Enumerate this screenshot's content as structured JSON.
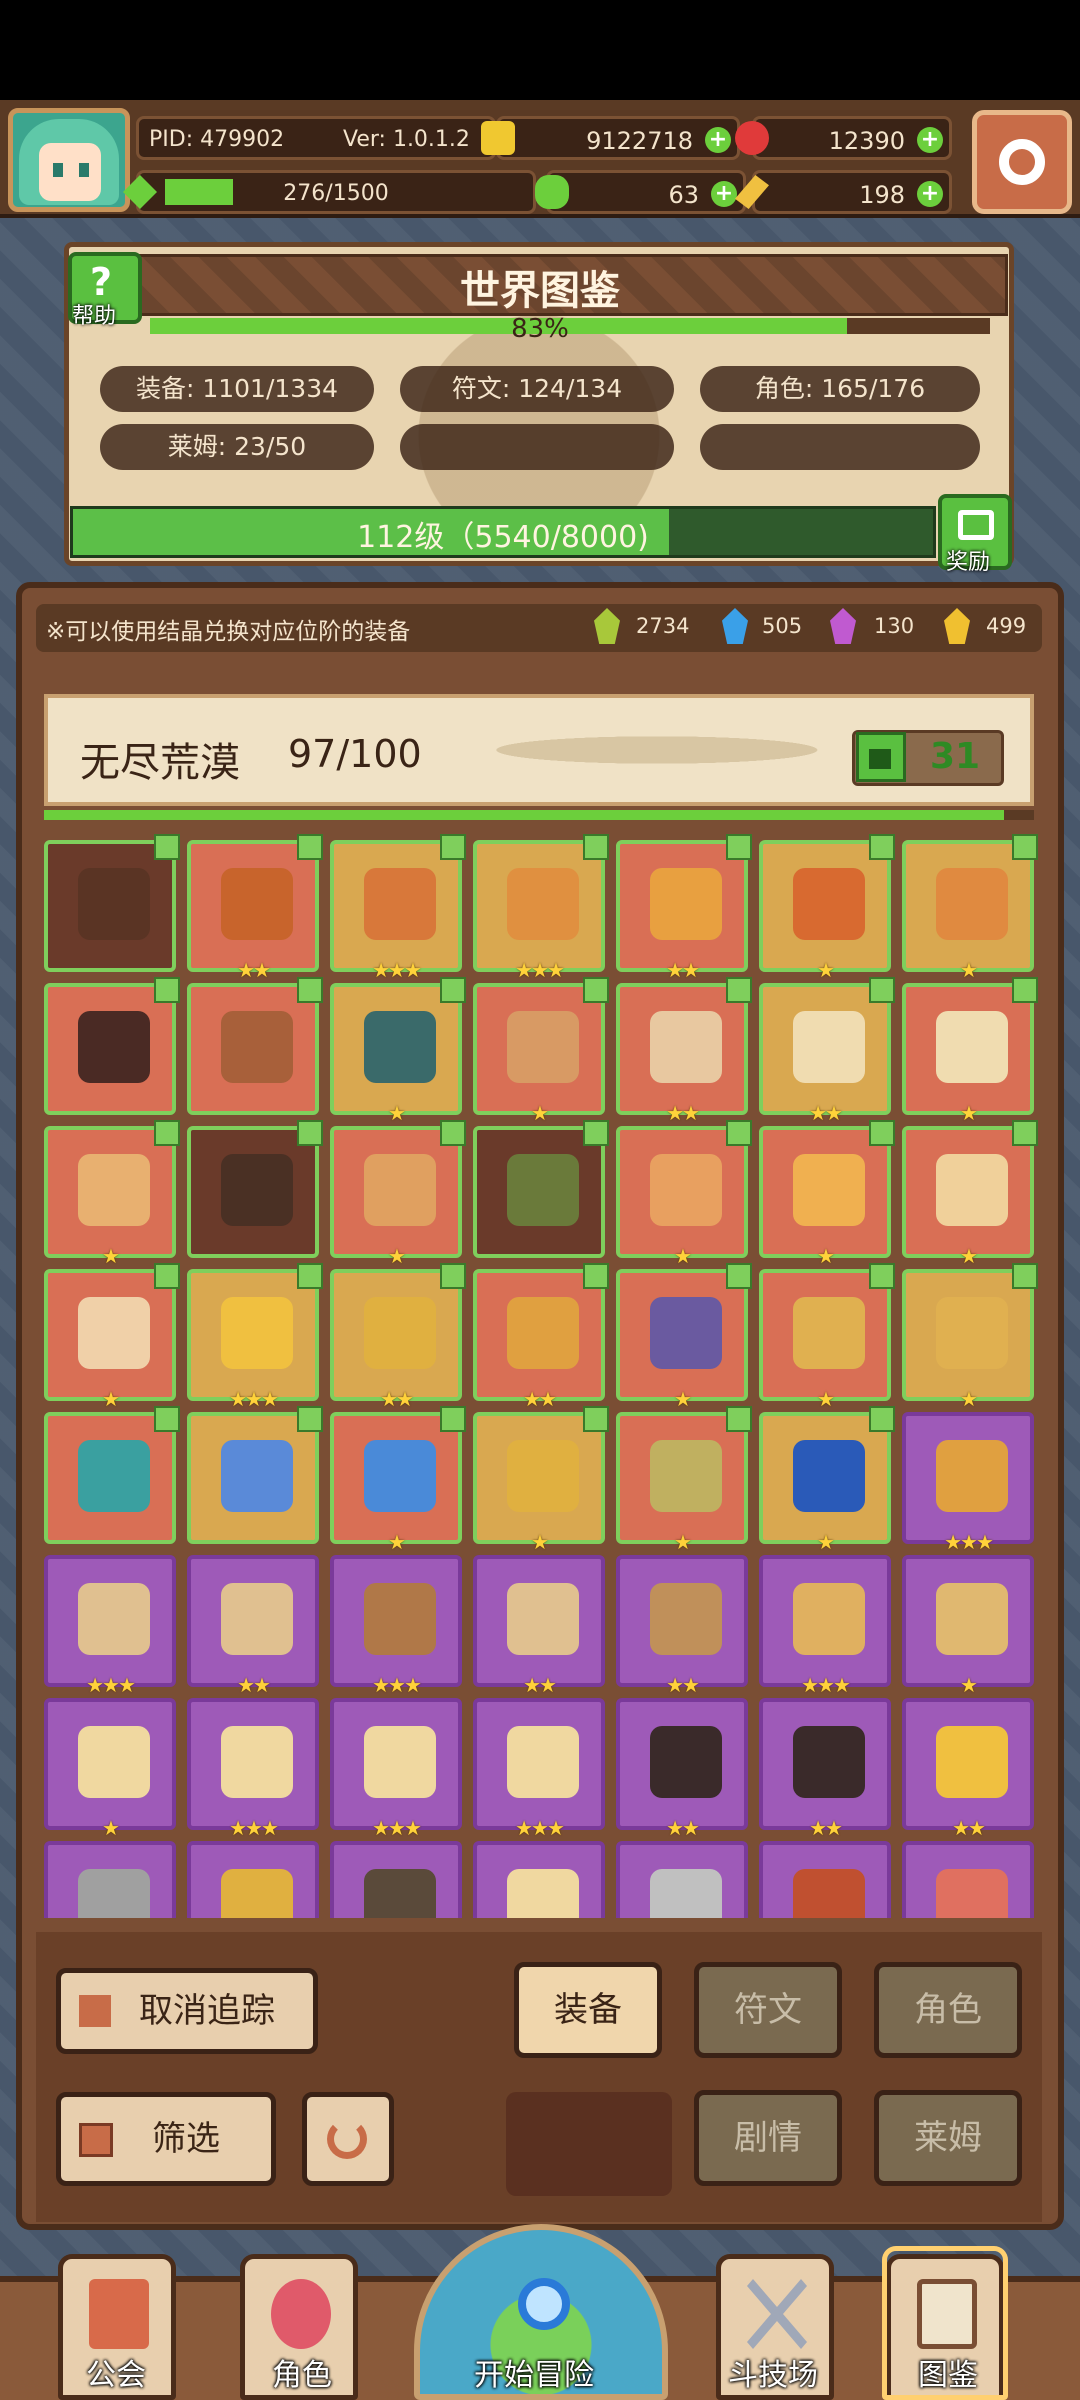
{
  "header": {
    "pid": "PID: 479902",
    "version": "Ver: 1.0.1.2",
    "gold": "9122718",
    "gems": "12390",
    "exp": "276/1500",
    "clover": "63",
    "pickaxe": "198",
    "exp_progress": 0.184
  },
  "world": {
    "title": "世界图鉴",
    "help_label": "帮助",
    "percent": "83%",
    "percent_value": 0.83,
    "stats": {
      "equipment": "装备: 1101/1334",
      "runes": "符文: 124/134",
      "characters": "角色: 165/176",
      "slime": "莱姆: 23/50"
    },
    "level_text": "112级（5540/8000)",
    "level_progress": 0.6925,
    "reward_label": "奖励"
  },
  "main": {
    "note": "※可以使用结晶兑换对应位阶的装备",
    "crystals": [
      {
        "name": "green-crystal",
        "value": "2734",
        "color": "#a8c83a"
      },
      {
        "name": "blue-crystal",
        "value": "505",
        "color": "#3aa0e8"
      },
      {
        "name": "purple-crystal",
        "value": "130",
        "color": "#c05ad0"
      },
      {
        "name": "gold-crystal",
        "value": "499",
        "color": "#f0c030"
      }
    ],
    "zone": {
      "name": "无尽荒漠",
      "count": "97/100",
      "likes": "31",
      "progress": 0.97
    },
    "items": [
      {
        "name": "dark-chest-armor",
        "rarity": "dark",
        "stars": "",
        "art": "#5a3424"
      },
      {
        "name": "leather-vest",
        "rarity": "red",
        "stars": "★★",
        "art": "#c8642c"
      },
      {
        "name": "bronze-armor",
        "rarity": "gold",
        "stars": "★★★",
        "art": "#d8783a"
      },
      {
        "name": "bronze-gauntlet",
        "rarity": "gold",
        "stars": "★★★",
        "art": "#e09040"
      },
      {
        "name": "gold-armor",
        "rarity": "red",
        "stars": "★★",
        "art": "#e8a040"
      },
      {
        "name": "copper-belt-armor",
        "rarity": "gold",
        "stars": "★",
        "art": "#d86a30"
      },
      {
        "name": "bronze-boots",
        "rarity": "gold",
        "stars": "★",
        "art": "#e08a40"
      },
      {
        "name": "jade-ring",
        "rarity": "red",
        "stars": "",
        "art": "#4a2a24"
      },
      {
        "name": "leather-boots",
        "rarity": "red",
        "stars": "",
        "art": "#a8603a"
      },
      {
        "name": "teal-necklace",
        "rarity": "gold",
        "stars": "★",
        "art": "#3a6a6a"
      },
      {
        "name": "wooden-staff",
        "rarity": "red",
        "stars": "★",
        "art": "#d89a64"
      },
      {
        "name": "tan-robe",
        "rarity": "red",
        "stars": "★★",
        "art": "#e8c8a0"
      },
      {
        "name": "cloth-bracer",
        "rarity": "gold",
        "stars": "★★",
        "art": "#f0dcb0"
      },
      {
        "name": "cloth-glove",
        "rarity": "red",
        "stars": "★",
        "art": "#f0dcb0"
      },
      {
        "name": "compass-amulet",
        "rarity": "red",
        "stars": "★",
        "art": "#e8b070"
      },
      {
        "name": "dark-shield",
        "rarity": "dark",
        "stars": "",
        "art": "#4a3024"
      },
      {
        "name": "heart-necklace",
        "rarity": "red",
        "stars": "★",
        "art": "#e0a060"
      },
      {
        "name": "green-wand",
        "rarity": "dark",
        "stars": "",
        "art": "#6a7a3a"
      },
      {
        "name": "gold-crown-armor",
        "rarity": "red",
        "stars": "★",
        "art": "#e8a060"
      },
      {
        "name": "gold-scepter",
        "rarity": "red",
        "stars": "★",
        "art": "#f0b050"
      },
      {
        "name": "sand-orb",
        "rarity": "red",
        "stars": "★",
        "art": "#f0d09a"
      },
      {
        "name": "tan-tunic",
        "rarity": "red",
        "stars": "★",
        "art": "#f0d0a8"
      },
      {
        "name": "emerald-crest",
        "rarity": "gold",
        "stars": "★★★",
        "art": "#f0c040"
      },
      {
        "name": "emerald-necklace",
        "rarity": "gold",
        "stars": "★★",
        "art": "#e0b040"
      },
      {
        "name": "emerald-ring",
        "rarity": "red",
        "stars": "★★",
        "art": "#e0a040"
      },
      {
        "name": "jewel-staff",
        "rarity": "red",
        "stars": "★",
        "art": "#6a5aa0"
      },
      {
        "name": "gold-staff",
        "rarity": "red",
        "stars": "★",
        "art": "#e0b050"
      },
      {
        "name": "gold-sapphire-orb",
        "rarity": "gold",
        "stars": "★",
        "art": "#e0b050"
      },
      {
        "name": "circlet-crown",
        "rarity": "red",
        "stars": "",
        "art": "#3aa0a0"
      },
      {
        "name": "blue-scroll",
        "rarity": "gold",
        "stars": "",
        "art": "#5a8ad8"
      },
      {
        "name": "sapphire-tiara",
        "rarity": "red",
        "stars": "★",
        "art": "#4a8ad8"
      },
      {
        "name": "genie-lamp",
        "rarity": "gold",
        "stars": "★",
        "art": "#e0b040"
      },
      {
        "name": "ruby-necklace",
        "rarity": "red",
        "stars": "★",
        "art": "#c0b060"
      },
      {
        "name": "ruby-ring",
        "rarity": "gold",
        "stars": "★",
        "art": "#2a5ab8"
      },
      {
        "name": "gold-heart-amulet",
        "rarity": "purple",
        "stars": "★★★",
        "art": "#e0a040"
      },
      {
        "name": "tan-hood",
        "rarity": "purple",
        "stars": "★★★",
        "art": "#e0c090"
      },
      {
        "name": "sand-armor",
        "rarity": "purple",
        "stars": "★★",
        "art": "#e0c090"
      },
      {
        "name": "leather-glove",
        "rarity": "purple",
        "stars": "★★★",
        "art": "#b07848"
      },
      {
        "name": "bone-ring",
        "rarity": "purple",
        "stars": "★★",
        "art": "#e0c090"
      },
      {
        "name": "tan-boots",
        "rarity": "purple",
        "stars": "★★",
        "art": "#c0905a"
      },
      {
        "name": "bone-club",
        "rarity": "purple",
        "stars": "★★★",
        "art": "#e0b060"
      },
      {
        "name": "sand-pearl",
        "rarity": "purple",
        "stars": "★",
        "art": "#e0b870"
      },
      {
        "name": "sand-hat",
        "rarity": "purple",
        "stars": "★",
        "art": "#f0d8a0"
      },
      {
        "name": "cloth-mitt",
        "rarity": "purple",
        "stars": "★★★",
        "art": "#f0d8a0"
      },
      {
        "name": "bone-bracelet",
        "rarity": "purple",
        "stars": "★★★",
        "art": "#f0d8a0"
      },
      {
        "name": "cloth-shoes",
        "rarity": "purple",
        "stars": "★★★",
        "art": "#f0d8a0"
      },
      {
        "name": "black-gold-helm",
        "rarity": "purple",
        "stars": "★★",
        "art": "#3a2a2a"
      },
      {
        "name": "black-gold-armor",
        "rarity": "purple",
        "stars": "★★",
        "art": "#3a2a2a"
      },
      {
        "name": "black-gold-boots",
        "rarity": "purple",
        "stars": "★★",
        "art": "#f0c040"
      },
      {
        "name": "steel-sword",
        "rarity": "purple",
        "stars": "",
        "art": "#a0a0a0"
      },
      {
        "name": "gold-banner",
        "rarity": "purple",
        "stars": "",
        "art": "#e0b040"
      },
      {
        "name": "dark-ring",
        "rarity": "purple",
        "stars": "",
        "art": "#5a4a3a"
      },
      {
        "name": "bone-bow",
        "rarity": "purple",
        "stars": "",
        "art": "#f0d8a0"
      },
      {
        "name": "iron-spear",
        "rarity": "purple",
        "stars": "",
        "art": "#c0c0c0"
      },
      {
        "name": "red-cloak",
        "rarity": "purple",
        "stars": "",
        "art": "#c05030"
      },
      {
        "name": "pink-ring",
        "rarity": "purple",
        "stars": "",
        "art": "#e07060"
      }
    ]
  },
  "controls": {
    "untrack": "取消追踪",
    "filter": "筛选",
    "tabs": [
      "装备",
      "符文",
      "角色",
      "剧情",
      "莱姆"
    ]
  },
  "nav": {
    "guild": "公会",
    "character": "角色",
    "adventure": "开始冒险",
    "arena": "斗技场",
    "encyclopedia": "图鉴"
  }
}
